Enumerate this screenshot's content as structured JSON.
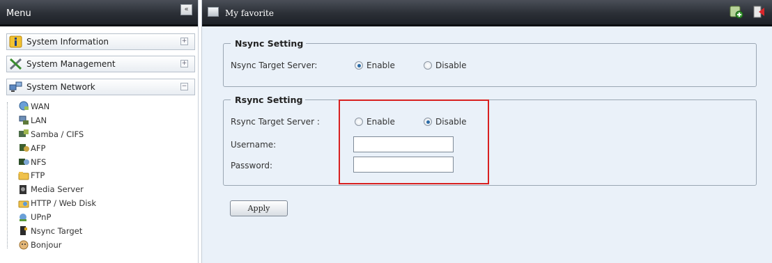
{
  "menu": {
    "title": "Menu",
    "collapse_glyph": "«",
    "categories": [
      {
        "label": "System Information",
        "icon": "info-icon",
        "toggle": "+"
      },
      {
        "label": "System Management",
        "icon": "tools-icon",
        "toggle": "+"
      },
      {
        "label": "System Network",
        "icon": "network-icon",
        "toggle": "−"
      }
    ],
    "network_items": [
      {
        "label": "WAN",
        "icon": "wan-icon"
      },
      {
        "label": "LAN",
        "icon": "lan-icon"
      },
      {
        "label": "Samba / CIFS",
        "icon": "samba-icon"
      },
      {
        "label": "AFP",
        "icon": "afp-icon"
      },
      {
        "label": "NFS",
        "icon": "nfs-icon"
      },
      {
        "label": "FTP",
        "icon": "ftp-icon"
      },
      {
        "label": "Media Server",
        "icon": "media-server-icon"
      },
      {
        "label": "HTTP / Web Disk",
        "icon": "http-icon"
      },
      {
        "label": "UPnP",
        "icon": "upnp-icon"
      },
      {
        "label": "Nsync Target",
        "icon": "nsync-icon"
      },
      {
        "label": "Bonjour",
        "icon": "bonjour-icon"
      }
    ]
  },
  "main": {
    "title": "My favorite",
    "nsync": {
      "legend": "Nsync Setting",
      "server_label": "Nsync Target Server:",
      "enable_label": "Enable",
      "disable_label": "Disable",
      "selected": "Enable"
    },
    "rsync": {
      "legend": "Rsync Setting",
      "server_label": "Rsync Target Server :",
      "enable_label": "Enable",
      "disable_label": "Disable",
      "selected": "Disable",
      "username_label": "Username:",
      "username_value": "",
      "password_label": "Password:",
      "password_value": ""
    },
    "apply_label": "Apply"
  },
  "colors": {
    "header_dark": "#2b2f36",
    "panel_bg": "#eaf1f9",
    "highlight": "#d82020",
    "radio_on": "#2a6aa6"
  }
}
